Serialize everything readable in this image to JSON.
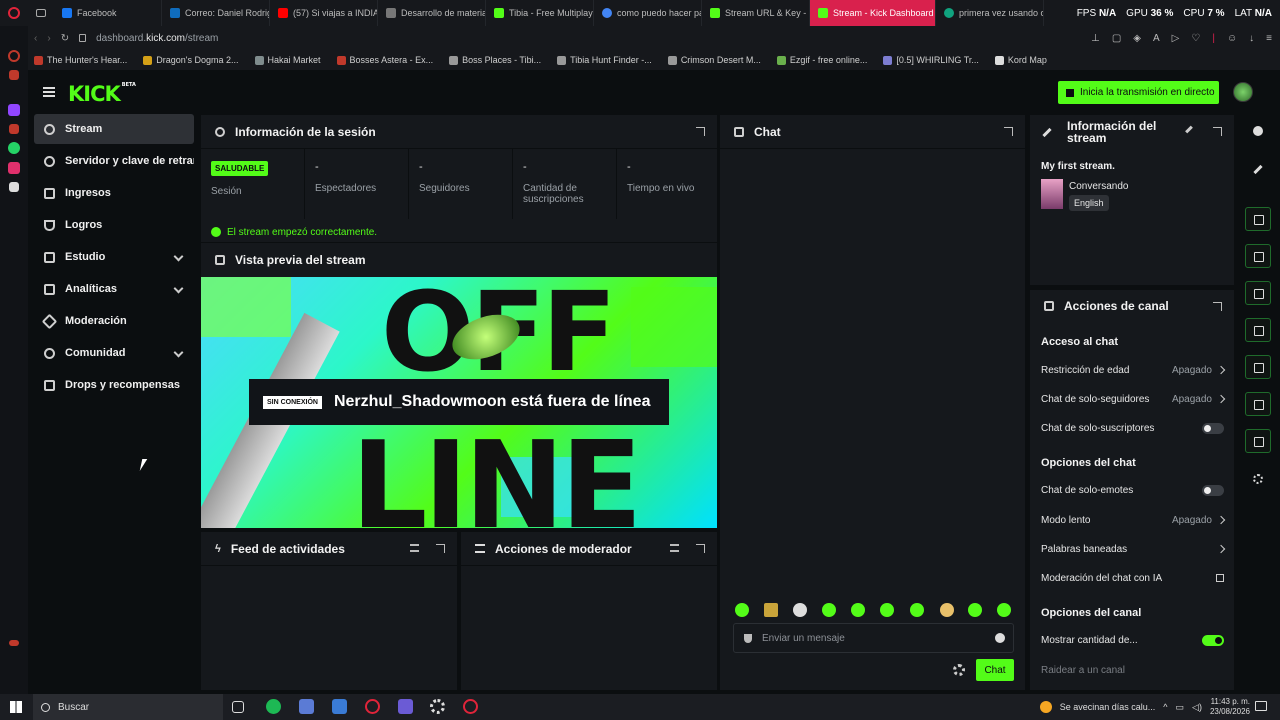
{
  "browser": {
    "tabs": [
      {
        "label": "Facebook",
        "color": "#1877f2"
      },
      {
        "label": "Correo: Daniel Rodrig",
        "color": "#0f6cbd"
      },
      {
        "label": "(57) Si viajas a INDIA",
        "color": "#ff0000"
      },
      {
        "label": "Desarrollo de materia",
        "color": "#555555"
      },
      {
        "label": "Tibia - Free Multiplaye",
        "color": "#53fc18"
      },
      {
        "label": "como puedo hacer pa",
        "color": "#4285f4"
      },
      {
        "label": "Stream URL & Key - K",
        "color": "#53fc18"
      },
      {
        "label": "Stream - Kick Dashboard",
        "color": "#53fc18"
      },
      {
        "label": "primera vez usando o",
        "color": "#10a37f"
      }
    ],
    "perf": {
      "fps_label": "FPS",
      "fps": "N/A",
      "gpu_label": "GPU",
      "gpu": "36 %",
      "cpu_label": "CPU",
      "cpu": "7 %",
      "lat_label": "LAT",
      "lat": "N/A"
    },
    "url_prefix": "dashboard.",
    "url_domain": "kick.com",
    "url_path": "/stream",
    "bookmarks": [
      {
        "label": "The Hunter's Hear...",
        "color": "#c0392b"
      },
      {
        "label": "Dragon's Dogma 2...",
        "color": "#d4a017"
      },
      {
        "label": "Hakai Market",
        "color": "#7f8c8d"
      },
      {
        "label": "Bosses Astera - Ex...",
        "color": "#c0392b"
      },
      {
        "label": "Boss Places - Tibi...",
        "color": "#999999"
      },
      {
        "label": "Tibia Hunt Finder -...",
        "color": "#999999"
      },
      {
        "label": "Crimson Desert M...",
        "color": "#999999"
      },
      {
        "label": "Ezgif - free online...",
        "color": "#6ab04c"
      },
      {
        "label": "[0.5] WHIRLING Tr...",
        "color": "#7d7dd1"
      },
      {
        "label": "Kord Map",
        "color": "#dddddd"
      }
    ]
  },
  "kick": {
    "logo": "KICK",
    "logo_sup": "BETA",
    "go_live": "Inicia la transmisión en directo"
  },
  "sidebar": {
    "items": [
      {
        "label": "Stream"
      },
      {
        "label": "Servidor y clave de retransmisión"
      },
      {
        "label": "Ingresos"
      },
      {
        "label": "Logros"
      },
      {
        "label": "Estudio"
      },
      {
        "label": "Analíticas"
      },
      {
        "label": "Moderación"
      },
      {
        "label": "Comunidad"
      },
      {
        "label": "Drops y recompensas"
      }
    ]
  },
  "session": {
    "title": "Información de la sesión",
    "status_badge": "SALUDABLE",
    "status_label": "Sesión",
    "metrics": [
      {
        "value": "-",
        "label": "Espectadores"
      },
      {
        "value": "-",
        "label": "Seguidores"
      },
      {
        "value": "-",
        "label": "Cantidad de suscripciones"
      },
      {
        "value": "-",
        "label": "Tiempo en vivo"
      }
    ],
    "ok_message": "El stream empezó correctamente."
  },
  "preview": {
    "title": "Vista previa del stream",
    "offline_tag": "SIN CONEXIÓN",
    "offline_text": "Nerzhul_Shadowmoon está fuera de línea",
    "bg_word1": "OFF",
    "bg_word2": "LINE"
  },
  "feed": {
    "title": "Feed de actividades"
  },
  "modactions": {
    "title": "Acciones de moderador"
  },
  "chat": {
    "title": "Chat",
    "input_placeholder": "Enviar un mensaje",
    "send_label": "Chat"
  },
  "stream_info": {
    "title": "Información del stream",
    "stream_title": "My first stream.",
    "category": "Conversando",
    "language": "English"
  },
  "channel_actions": {
    "title": "Acciones de canal",
    "sections": [
      {
        "title": "Acceso al chat"
      },
      {
        "title": "Opciones del chat"
      },
      {
        "title": "Opciones del canal"
      }
    ],
    "rows": [
      {
        "label": "Restricción de edad",
        "status": "Apagado"
      },
      {
        "label": "Chat de solo-seguidores",
        "status": "Apagado"
      },
      {
        "label": "Chat de solo-suscriptores",
        "toggle": "off"
      },
      {
        "label": "Chat de solo-emotes",
        "toggle": "off"
      },
      {
        "label": "Modo lento",
        "status": "Apagado"
      },
      {
        "label": "Palabras baneadas",
        "status": ""
      },
      {
        "label": "Moderación del chat con IA",
        "status": ""
      },
      {
        "label": "Mostrar cantidad de...",
        "toggle": "on"
      },
      {
        "label": "Raidear a un canal",
        "status": ""
      }
    ]
  },
  "taskbar": {
    "search": "Buscar",
    "weather": "Se avecinan días calu...",
    "time": "11:43 p. m.",
    "date": "23/08/2026"
  }
}
